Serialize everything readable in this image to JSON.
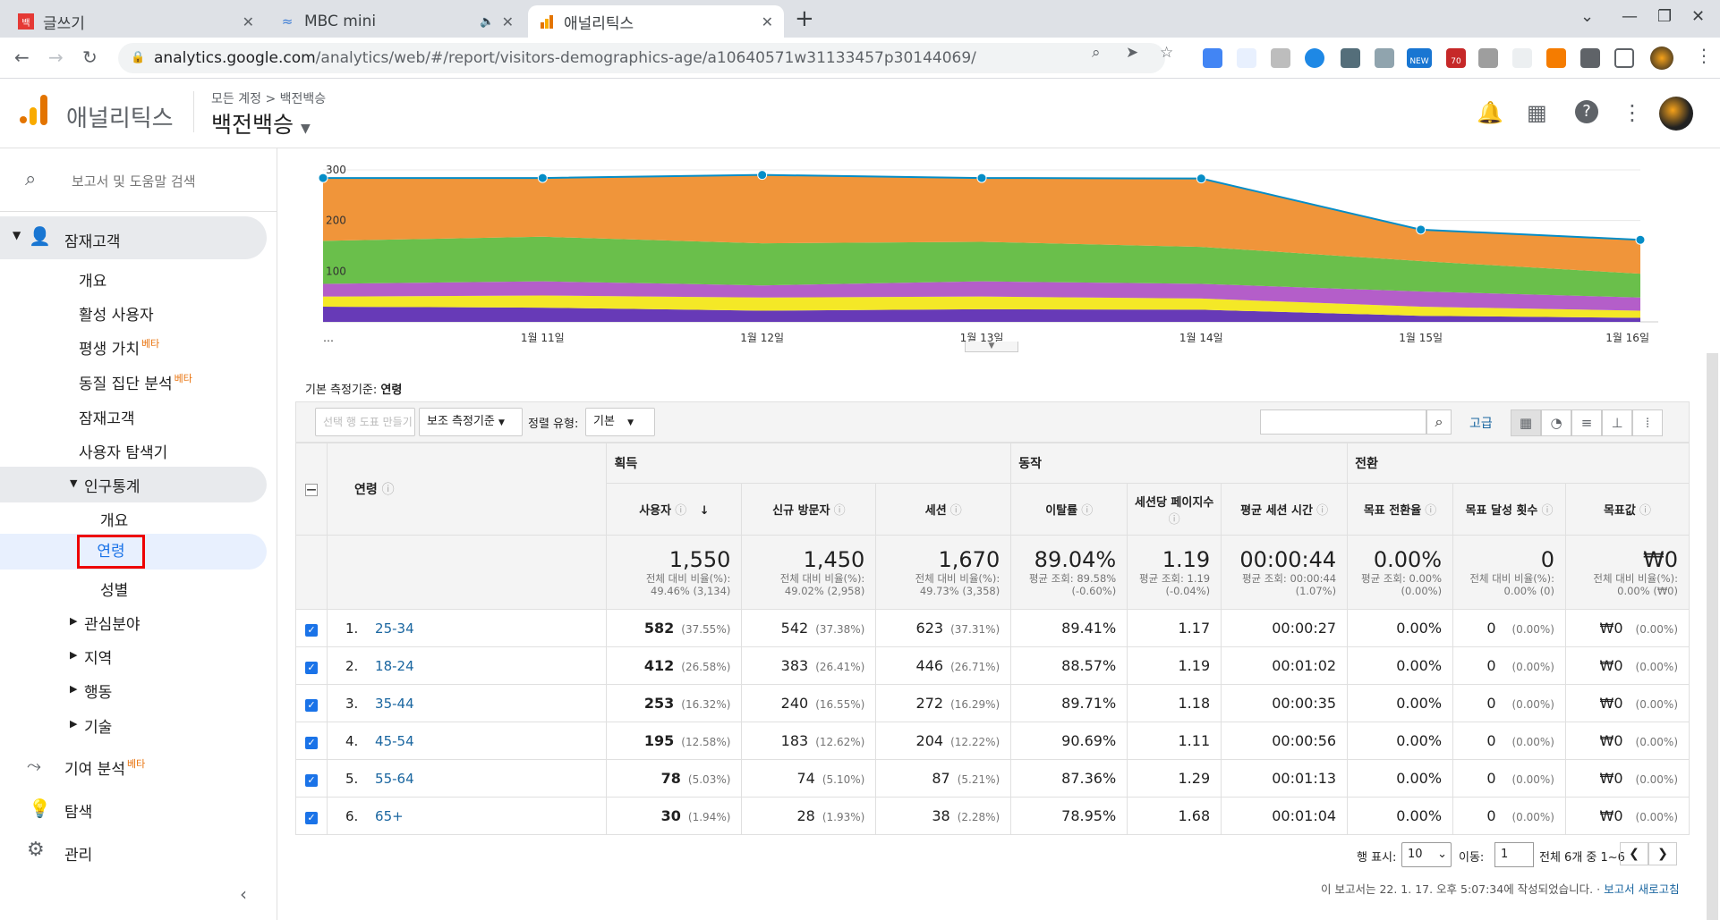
{
  "browser": {
    "tabs": [
      {
        "title": "글쓰기",
        "favicon": "red-square-icon"
      },
      {
        "title": "MBC mini",
        "favicon": "mbc-icon"
      },
      {
        "title": "애널리틱스",
        "favicon": "analytics-icon"
      }
    ],
    "url_host": "analytics.google.com",
    "url_path": "/analytics/web/#/report/visitors-demographics-age/a10640571w31133457p30144069/",
    "ext_badge_new": "NEW",
    "ext_badge_count": "70"
  },
  "header": {
    "app_name": "애널리틱스",
    "crumb_root": "모든 계정",
    "crumb_sep": ">",
    "crumb_account": "백전백승",
    "property": "백전백승"
  },
  "sidebar": {
    "search_placeholder": "보고서 및 도움말 검색",
    "audience": "잠재고객",
    "items": [
      "개요",
      "활성 사용자",
      "평생 가치",
      "동질 집단 분석",
      "잠재고객",
      "사용자 탐색기"
    ],
    "beta": "베타",
    "demographics": "인구통계",
    "demo_items": [
      "개요",
      "연령",
      "성별"
    ],
    "collapsed": [
      "관심분야",
      "지역",
      "행동",
      "기술"
    ],
    "attribution": "기여 분석",
    "discover": "탐색",
    "admin": "관리"
  },
  "chart_data": {
    "type": "area",
    "x": [
      "…",
      "1월 11일",
      "1월 12일",
      "1월 13일",
      "1월 14일",
      "1월 15일",
      "1월 16일"
    ],
    "y_ticks": [
      "100",
      "200",
      "300"
    ],
    "ylim": [
      0,
      300
    ],
    "series": [
      {
        "values": [
          30,
          28,
          22,
          25,
          24,
          12,
          8
        ],
        "color": "#673ab7"
      },
      {
        "values": [
          50,
          52,
          48,
          50,
          46,
          30,
          22
        ],
        "color": "#f4e827"
      },
      {
        "values": [
          75,
          80,
          72,
          80,
          75,
          60,
          48
        ],
        "color": "#b45ec9"
      },
      {
        "values": [
          160,
          168,
          155,
          158,
          148,
          120,
          95
        ],
        "color": "#6abf4b"
      },
      {
        "values": [
          284,
          284,
          290,
          284,
          283,
          182,
          162
        ],
        "color": "#f0953a"
      }
    ]
  },
  "report": {
    "primary_dim_label": "기본 측정기준:",
    "primary_dim_value": "연령",
    "btn_plot": "선택 행 도표 만들기",
    "btn_secondary": "보조 측정기준",
    "sort_label": "정렬 유형:",
    "sort_value": "기본",
    "advanced": "고급",
    "groups": {
      "acq": "획득",
      "beh": "동작",
      "conv": "전환"
    },
    "col_dim": "연령",
    "columns": [
      "사용자",
      "신규 방문자",
      "세션",
      "이탈률",
      "세션당 페이지수",
      "평균 세션 시간",
      "목표 전환율",
      "목표 달성 횟수",
      "목표값"
    ],
    "totals": [
      {
        "v": "1,550",
        "s1": "전체 대비 비율(%):",
        "s2": "49.46% (3,134)"
      },
      {
        "v": "1,450",
        "s1": "전체 대비 비율(%):",
        "s2": "49.02% (2,958)"
      },
      {
        "v": "1,670",
        "s1": "전체 대비 비율(%):",
        "s2": "49.73% (3,358)"
      },
      {
        "v": "89.04%",
        "s1": "평균 조회: 89.58%",
        "s2": "(-0.60%)"
      },
      {
        "v": "1.19",
        "s1": "평균 조회: 1.19",
        "s2": "(-0.04%)"
      },
      {
        "v": "00:00:44",
        "s1": "평균 조회: 00:00:44",
        "s2": "(1.07%)"
      },
      {
        "v": "0.00%",
        "s1": "평균 조회: 0.00%",
        "s2": "(0.00%)"
      },
      {
        "v": "0",
        "s1": "전체 대비 비율(%):",
        "s2": "0.00% (0)"
      },
      {
        "v": "₩0",
        "s1": "전체 대비 비율(%):",
        "s2": "0.00% (₩0)"
      }
    ],
    "rows": [
      {
        "n": "1.",
        "age": "25-34",
        "users": "582",
        "users_p": "(37.55%)",
        "new": "542",
        "new_p": "(37.38%)",
        "sess": "623",
        "sess_p": "(37.31%)",
        "bounce": "89.41%",
        "pps": "1.17",
        "dur": "00:00:27",
        "cr": "0.00%",
        "gc": "0",
        "gc_p": "(0.00%)",
        "gv": "₩0",
        "gv_p": "(0.00%)"
      },
      {
        "n": "2.",
        "age": "18-24",
        "users": "412",
        "users_p": "(26.58%)",
        "new": "383",
        "new_p": "(26.41%)",
        "sess": "446",
        "sess_p": "(26.71%)",
        "bounce": "88.57%",
        "pps": "1.19",
        "dur": "00:01:02",
        "cr": "0.00%",
        "gc": "0",
        "gc_p": "(0.00%)",
        "gv": "₩0",
        "gv_p": "(0.00%)"
      },
      {
        "n": "3.",
        "age": "35-44",
        "users": "253",
        "users_p": "(16.32%)",
        "new": "240",
        "new_p": "(16.55%)",
        "sess": "272",
        "sess_p": "(16.29%)",
        "bounce": "89.71%",
        "pps": "1.18",
        "dur": "00:00:35",
        "cr": "0.00%",
        "gc": "0",
        "gc_p": "(0.00%)",
        "gv": "₩0",
        "gv_p": "(0.00%)"
      },
      {
        "n": "4.",
        "age": "45-54",
        "users": "195",
        "users_p": "(12.58%)",
        "new": "183",
        "new_p": "(12.62%)",
        "sess": "204",
        "sess_p": "(12.22%)",
        "bounce": "90.69%",
        "pps": "1.11",
        "dur": "00:00:56",
        "cr": "0.00%",
        "gc": "0",
        "gc_p": "(0.00%)",
        "gv": "₩0",
        "gv_p": "(0.00%)"
      },
      {
        "n": "5.",
        "age": "55-64",
        "users": "78",
        "users_p": "(5.03%)",
        "new": "74",
        "new_p": "(5.10%)",
        "sess": "87",
        "sess_p": "(5.21%)",
        "bounce": "87.36%",
        "pps": "1.29",
        "dur": "00:01:13",
        "cr": "0.00%",
        "gc": "0",
        "gc_p": "(0.00%)",
        "gv": "₩0",
        "gv_p": "(0.00%)"
      },
      {
        "n": "6.",
        "age": "65+",
        "users": "30",
        "users_p": "(1.94%)",
        "new": "28",
        "new_p": "(1.93%)",
        "sess": "38",
        "sess_p": "(2.28%)",
        "bounce": "78.95%",
        "pps": "1.68",
        "dur": "00:01:04",
        "cr": "0.00%",
        "gc": "0",
        "gc_p": "(0.00%)",
        "gv": "₩0",
        "gv_p": "(0.00%)"
      }
    ],
    "rows_label": "행 표시:",
    "rows_value": "10",
    "goto_label": "이동:",
    "goto_value": "1",
    "range_text": "전체 6개 중 1~6",
    "footer_text": "이 보고서는 22. 1. 17. 오후 5:07:34에 작성되었습니다. ·",
    "refresh": "보고서 새로고침"
  }
}
